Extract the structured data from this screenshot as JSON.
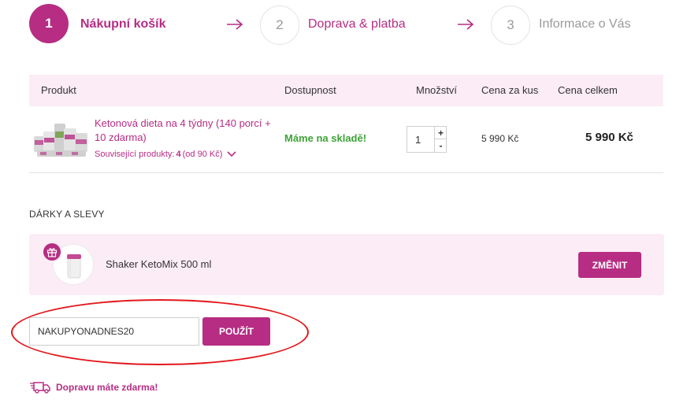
{
  "steps": [
    {
      "number": "1",
      "label": "Nákupní košík"
    },
    {
      "number": "2",
      "label": "Doprava & platba"
    },
    {
      "number": "3",
      "label": "Informace o Vás"
    }
  ],
  "table": {
    "headers": [
      "Produkt",
      "Dostupnost",
      "Množství",
      "Cena za kus",
      "Cena celkem"
    ],
    "row": {
      "name": "Ketonová dieta na 4 týdny (140 porcí + 10 zdarma)",
      "related_prefix": "Související produkty:",
      "related_count": "4",
      "related_suffix": "(od 90 Kč)",
      "availability": "Máme na skladě!",
      "quantity": "1",
      "unit_price": "5 990 Kč",
      "total_price": "5 990 Kč"
    }
  },
  "gifts": {
    "title": "DÁRKY A SLEVY",
    "item_name": "Shaker KetoMix 500 ml",
    "change_label": "ZMĚNIT"
  },
  "coupon": {
    "value": "NAKUPYONADNES20",
    "apply_label": "POUŽÍT"
  },
  "shipping": {
    "text": "Dopravu máte zdarma!"
  },
  "colors": {
    "accent": "#b62d83",
    "accent_light": "#fbecf5",
    "in_stock": "#3da336",
    "annotation": "#e3171c"
  },
  "icons": {
    "step_arrow": "arrow-right-icon",
    "related_toggle": "chevron-down-icon",
    "gift_badge": "gift-icon",
    "shipping": "truck-icon"
  }
}
